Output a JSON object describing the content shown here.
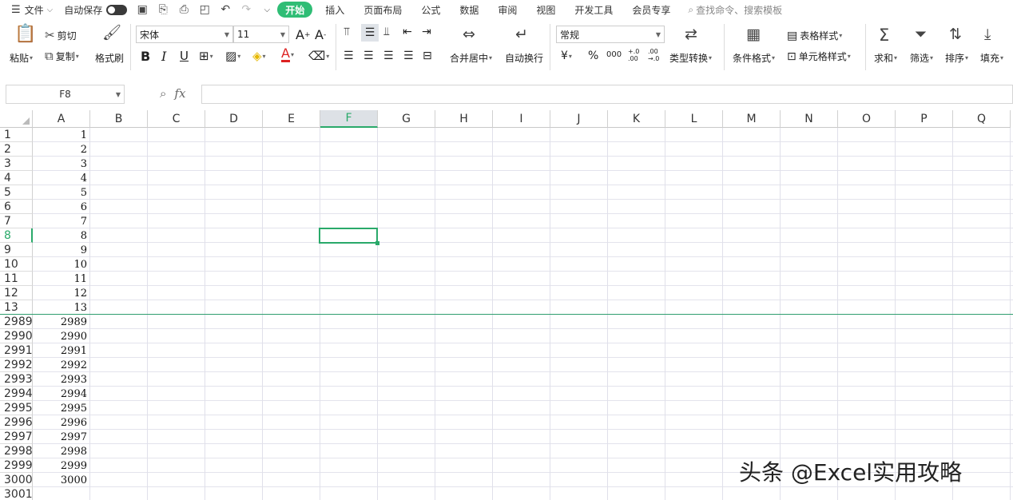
{
  "menubar": {
    "hamburger": "☰",
    "file": "文件",
    "file_arrow": "⌵",
    "autosave": "自动保存",
    "tabs": [
      "开始",
      "插入",
      "页面布局",
      "公式",
      "数据",
      "审阅",
      "视图",
      "开发工具",
      "会员专享"
    ],
    "search": "查找命令、搜索模板"
  },
  "ribbon": {
    "paste": "粘贴",
    "cut": "剪切",
    "copy": "复制",
    "format_painter": "格式刷",
    "font_name": "宋体",
    "font_size": "11",
    "merge_center": "合并居中",
    "wrap_text": "自动换行",
    "number_format": "常规",
    "currency": "¥",
    "percent": "%",
    "thousands": "000",
    "inc_decimal": "+.0 .00",
    "dec_decimal": ".00 →.0",
    "type_convert": "类型转换",
    "conditional_format": "条件格式",
    "table_style": "表格样式",
    "cell_style": "单元格样式",
    "sum": "求和",
    "filter": "筛选",
    "sort": "排序",
    "fill": "填充"
  },
  "formula_bar": {
    "name_box": "F8",
    "fx": "fx",
    "formula": ""
  },
  "sheet": {
    "columns": [
      "A",
      "B",
      "C",
      "D",
      "E",
      "F",
      "G",
      "H",
      "I",
      "J",
      "K",
      "L",
      "M",
      "N",
      "O",
      "P",
      "Q"
    ],
    "selected_column": "F",
    "selected_row": "8",
    "rows": [
      {
        "header": "1",
        "a": "1"
      },
      {
        "header": "2",
        "a": "2"
      },
      {
        "header": "3",
        "a": "3"
      },
      {
        "header": "4",
        "a": "4"
      },
      {
        "header": "5",
        "a": "5"
      },
      {
        "header": "6",
        "a": "6"
      },
      {
        "header": "7",
        "a": "7"
      },
      {
        "header": "8",
        "a": "8"
      },
      {
        "header": "9",
        "a": "9"
      },
      {
        "header": "10",
        "a": "10"
      },
      {
        "header": "11",
        "a": "11"
      },
      {
        "header": "12",
        "a": "12"
      },
      {
        "header": "13",
        "a": "13"
      },
      {
        "header": "2989",
        "a": "2989"
      },
      {
        "header": "2990",
        "a": "2990"
      },
      {
        "header": "2991",
        "a": "2991"
      },
      {
        "header": "2992",
        "a": "2992"
      },
      {
        "header": "2993",
        "a": "2993"
      },
      {
        "header": "2994",
        "a": "2994"
      },
      {
        "header": "2995",
        "a": "2995"
      },
      {
        "header": "2996",
        "a": "2996"
      },
      {
        "header": "2997",
        "a": "2997"
      },
      {
        "header": "2998",
        "a": "2998"
      },
      {
        "header": "2999",
        "a": "2999"
      },
      {
        "header": "3000",
        "a": "3000"
      },
      {
        "header": "3001",
        "a": ""
      }
    ]
  },
  "watermark": "头条 @Excel实用攻略",
  "colors": {
    "accent": "#2fbd75",
    "freeze_line": "#2f9e6e"
  }
}
